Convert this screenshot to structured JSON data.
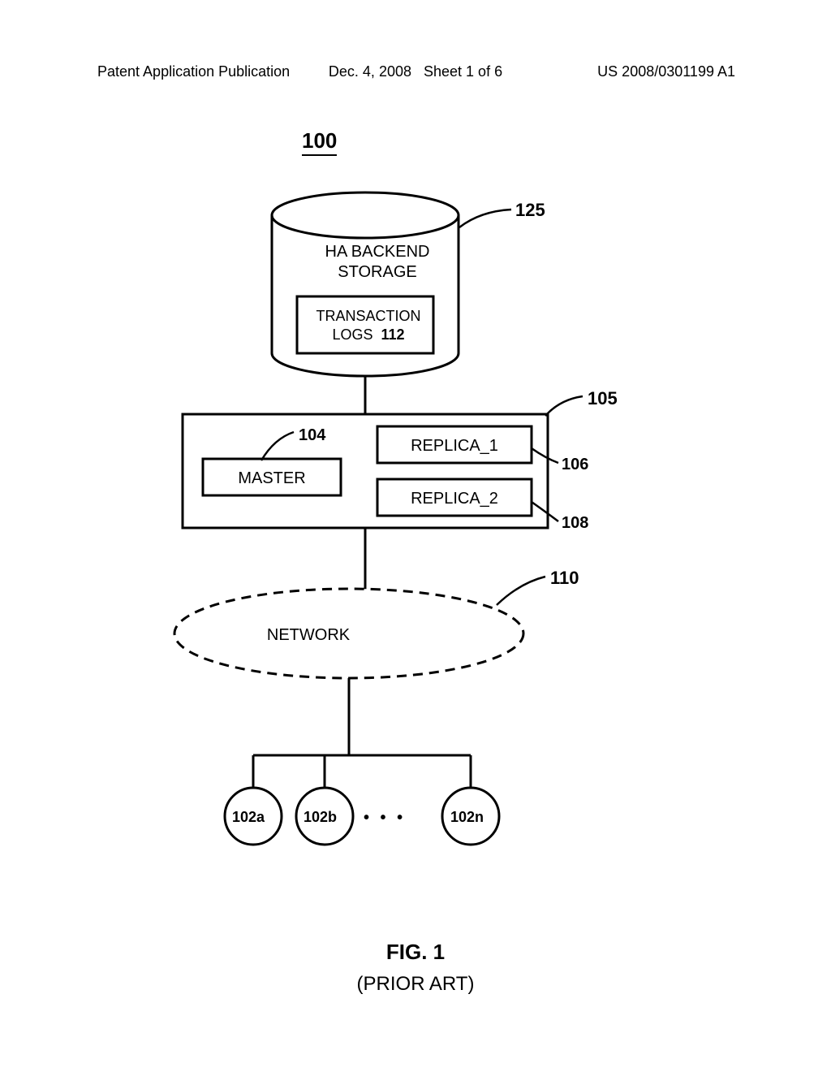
{
  "header": {
    "left": "Patent Application Publication",
    "center_date": "Dec. 4, 2008",
    "center_sheet": "Sheet 1 of 6",
    "right": "US 2008/0301199 A1"
  },
  "figure_number": "100",
  "storage": {
    "title_l1": "HA BACKEND",
    "title_l2": "STORAGE",
    "logs_l1": "TRANSACTION",
    "logs_l2": "LOGS",
    "logs_ref": "112",
    "ref": "125"
  },
  "server_box": {
    "ref": "105",
    "master_label": "MASTER",
    "master_ref": "104",
    "replica1_label": "REPLICA_1",
    "replica1_ref": "106",
    "replica2_label": "REPLICA_2",
    "replica2_ref": "108"
  },
  "network": {
    "label": "NETWORK",
    "ref": "110"
  },
  "clients": {
    "a": "102a",
    "b": "102b",
    "n": "102n",
    "dots": "• • •"
  },
  "caption": {
    "fig": "FIG. 1",
    "prior": "(PRIOR ART)"
  }
}
